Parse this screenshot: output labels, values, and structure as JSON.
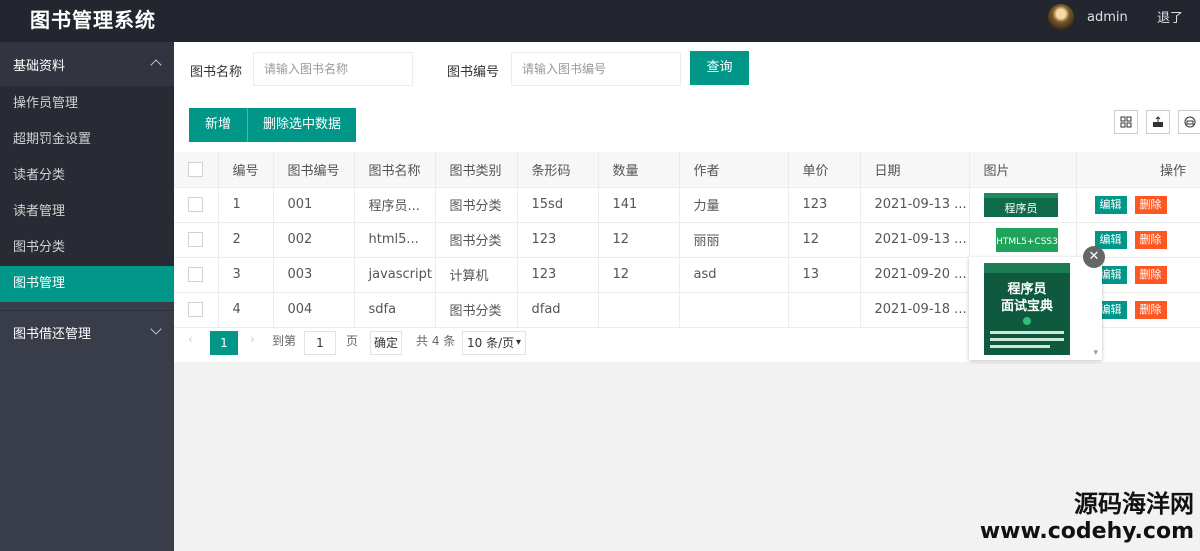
{
  "header": {
    "title": "图书管理系统",
    "username": "admin",
    "logout_label": "退了"
  },
  "sidebar": {
    "group1": "基础资料",
    "items": [
      "操作员管理",
      "超期罚金设置",
      "读者分类",
      "读者管理",
      "图书分类",
      "图书管理"
    ],
    "group2": "图书借还管理"
  },
  "search": {
    "name_label": "图书名称",
    "name_placeholder": "请输入图书名称",
    "code_label": "图书编号",
    "code_placeholder": "请输入图书编号",
    "query_label": "查询"
  },
  "toolbar": {
    "add_label": "新增",
    "delete_selected_label": "删除选中数据"
  },
  "table": {
    "headers": [
      "编号",
      "图书编号",
      "图书名称",
      "图书类别",
      "条形码",
      "数量",
      "作者",
      "单价",
      "日期",
      "图片",
      "操作"
    ],
    "rows": [
      [
        "1",
        "001",
        "程序员...",
        "图书分类",
        "15sd",
        "141",
        "力量",
        "123",
        "2021-09-13 ..."
      ],
      [
        "2",
        "002",
        "html5...",
        "图书分类",
        "123",
        "12",
        "丽丽",
        "12",
        "2021-09-13 ..."
      ],
      [
        "3",
        "003",
        "javascript",
        "计算机",
        "123",
        "12",
        "asd",
        "13",
        "2021-09-20 ..."
      ],
      [
        "4",
        "004",
        "sdfa",
        "图书分类",
        "dfad",
        "",
        "",
        "",
        "2021-09-18 ..."
      ]
    ],
    "edit_label": "编辑",
    "delete_label": "删除",
    "thumbs": [
      "程序员",
      "HTML5+CSS3",
      "",
      ""
    ]
  },
  "pager": {
    "current_page": "1",
    "goto_label": "到第",
    "goto_value": "1",
    "page_suffix": "页",
    "confirm_label": "确定",
    "total_label": "共 4 条",
    "per_page": "10 条/页"
  },
  "preview": {
    "title": "程序员",
    "subtitle": "面试宝典"
  },
  "watermark": {
    "line1": "源码海洋网",
    "line2": "www.codehy.com"
  },
  "colors": {
    "accent": "#009688",
    "danger": "#ff5722",
    "header_bg": "#23262e",
    "sidebar_bg": "#393d49"
  }
}
